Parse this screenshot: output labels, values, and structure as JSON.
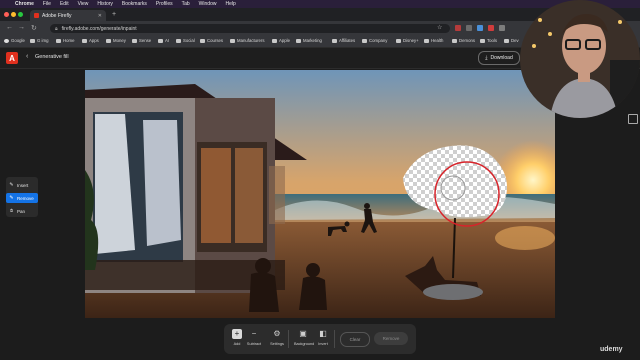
{
  "menubar": {
    "app": "Chrome",
    "items": [
      "File",
      "Edit",
      "View",
      "History",
      "Bookmarks",
      "Profiles",
      "Tab",
      "Window",
      "Help"
    ]
  },
  "browser": {
    "tab_title": "Adobe Firefly",
    "url": "firefly.adobe.com/generate/inpaint",
    "bookmarks": [
      "Google",
      "G img",
      "Home",
      "Apps",
      "Money",
      "Sense",
      "AI",
      "Social",
      "Courses",
      "Manufacturers",
      "Apple",
      "Marketing",
      "Affiliates",
      "Company",
      "Disney+",
      "Health",
      "Demons",
      "Tools",
      "Dev"
    ]
  },
  "app": {
    "title": "Generative fill",
    "download_label": "Download"
  },
  "tools": [
    {
      "label": "Insert",
      "icon": "brush-plus-icon",
      "active": false
    },
    {
      "label": "Remove",
      "icon": "brush-minus-icon",
      "active": true
    },
    {
      "label": "Pan",
      "icon": "hand-icon",
      "active": false
    }
  ],
  "bottom_toolbar": {
    "tools": [
      {
        "label": "Add",
        "icon": "add-icon",
        "active": true
      },
      {
        "label": "Subtract",
        "icon": "subtract-icon",
        "active": false
      },
      {
        "label": "Settings",
        "icon": "settings-icon",
        "active": false
      },
      {
        "label": "Background",
        "icon": "background-icon",
        "active": false
      },
      {
        "label": "Invert",
        "icon": "invert-icon",
        "active": false
      }
    ],
    "clear_label": "Clear",
    "remove_label": "Remove"
  },
  "watermark": "udemy",
  "colors": {
    "accent": "#1473e6",
    "brand": "#e0301e",
    "selection_ring": "#d8232a"
  }
}
